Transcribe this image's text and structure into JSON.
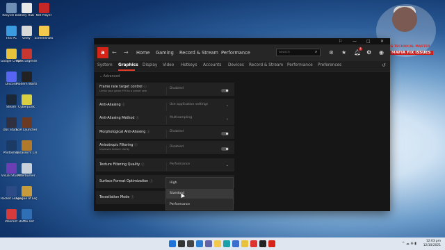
{
  "desktop": {
    "icons": [
      {
        "label": "Recycle Bin",
        "color": "#6f8fb5"
      },
      {
        "label": "Unity Hub",
        "color": "#e8e8e8"
      },
      {
        "label": "Net Player",
        "color": "#c62828"
      },
      {
        "label": "This PC",
        "color": "#3a9be0"
      },
      {
        "label": "Unity",
        "color": "#d8d8d8"
      },
      {
        "label": "Screenshots",
        "color": "#f2c94c"
      },
      {
        "label": "Google Chrome",
        "color": "#e8c23a"
      },
      {
        "label": "Apex Legends",
        "color": "#c8372f"
      },
      {
        "label": "Discord",
        "color": "#5865f2"
      },
      {
        "label": "Modern Warfare",
        "color": "#222"
      },
      {
        "label": "Steam",
        "color": "#1b2838"
      },
      {
        "label": "Cyberpunk",
        "color": "#d8d040"
      },
      {
        "label": "Obs Studio",
        "color": "#303040"
      },
      {
        "label": "GTA Launcher",
        "color": "#6b3a23"
      },
      {
        "label": "Photoshop",
        "color": "#1b3a66"
      },
      {
        "label": "Assassin's Creed",
        "color": "#b07a2a"
      },
      {
        "label": "Visual Studio",
        "color": "#6b3fb3"
      },
      {
        "label": "Afterburner",
        "color": "#c8d0da"
      },
      {
        "label": "Rocket League",
        "color": "#2c4a86"
      },
      {
        "label": "League of Legends",
        "color": "#c79b3b"
      },
      {
        "label": "Valorant",
        "color": "#d63a3a"
      },
      {
        "label": "Battle.net",
        "color": "#2f6fb5"
      }
    ]
  },
  "window": {
    "title_controls": [
      "⚐",
      "—",
      "□",
      "✕"
    ],
    "logo_text": "a",
    "nav_back": "←",
    "nav_forward": "→",
    "topnav": [
      "Home",
      "Gaming",
      "Record & Stream",
      "Performance"
    ],
    "search_placeholder": "Search",
    "nav_icons": [
      "bug-icon",
      "star-icon",
      "bell-icon",
      "settings-icon",
      "user-icon"
    ],
    "notification_count": "1",
    "subnav": [
      "System",
      "Graphics",
      "Display",
      "Video",
      "Hotkeys",
      "Accounts",
      "Devices",
      "Record & Stream",
      "Performance",
      "Preferences"
    ],
    "active_tab": "Graphics",
    "advanced_label": "Advanced",
    "settings": [
      {
        "label": "Frame rate target control",
        "sub": "Limits your game FPS to a preset rate",
        "value": "Disabled",
        "control": "toggle"
      },
      {
        "label": "Anti-Aliasing",
        "sub": "",
        "value": "Use application settings",
        "control": "chevron"
      },
      {
        "label": "Anti-Aliasing Method",
        "sub": "",
        "value": "Multisampling",
        "control": "chevron"
      },
      {
        "label": "Morphological Anti-Aliasing",
        "sub": "",
        "value": "Disabled",
        "control": "toggle"
      },
      {
        "label": "Anisotropic Filtering",
        "sub": "Improves texture clarity",
        "value": "Disabled",
        "control": "toggle"
      },
      {
        "label": "Texture Filtering Quality",
        "sub": "",
        "value": "Performance",
        "control": "chevron"
      },
      {
        "label": "Surface Format Optimization",
        "sub": "",
        "value": "",
        "control": "none"
      },
      {
        "label": "Tessellation Mode",
        "sub": "",
        "value": "",
        "control": "none"
      }
    ],
    "dropdown_options": [
      "High",
      "Standard",
      "Performance"
    ],
    "dropdown_highlighted": "Standard"
  },
  "watermark": {
    "line1": "GAMING TECHNICAL MASTER",
    "line2": "MAFIA FIX ISSUES"
  },
  "taskbar": {
    "time": "12:03 pm",
    "date": "12/10/2021",
    "tray": "^ ☁ ⊕ ▮",
    "icons": [
      {
        "name": "windows-start-icon",
        "color": "#1e73d8"
      },
      {
        "name": "search-icon",
        "color": "#333"
      },
      {
        "name": "task-view-icon",
        "color": "#444"
      },
      {
        "name": "widgets-icon",
        "color": "#2b7cd3"
      },
      {
        "name": "teams-chat-icon",
        "color": "#6264a7"
      },
      {
        "name": "file-explorer-icon",
        "color": "#f2c94c"
      },
      {
        "name": "edge-icon",
        "color": "#1aa0a8"
      },
      {
        "name": "store-icon",
        "color": "#3a6fd0"
      },
      {
        "name": "chrome-icon",
        "color": "#e8c23a"
      },
      {
        "name": "media-player-icon",
        "color": "#d33"
      },
      {
        "name": "unity-icon",
        "color": "#222"
      },
      {
        "name": "amd-icon",
        "color": "#d62418"
      }
    ]
  }
}
